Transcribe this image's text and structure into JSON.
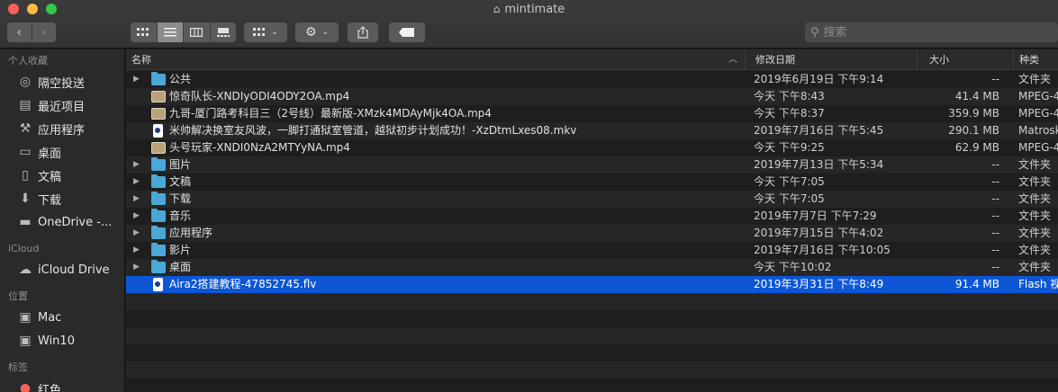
{
  "window": {
    "title": "mintimate"
  },
  "toolbar": {
    "back": "‹",
    "forward": "›",
    "search_placeholder": "搜索"
  },
  "sidebar": {
    "sections": [
      {
        "title": "个人收藏",
        "items": [
          {
            "label": "隔空投送",
            "icon": "airdrop-icon"
          },
          {
            "label": "最近项目",
            "icon": "recents-icon"
          },
          {
            "label": "应用程序",
            "icon": "applications-icon"
          },
          {
            "label": "桌面",
            "icon": "desktop-icon"
          },
          {
            "label": "文稿",
            "icon": "documents-icon"
          },
          {
            "label": "下载",
            "icon": "downloads-icon"
          },
          {
            "label": "OneDrive -...",
            "icon": "folder-icon"
          }
        ]
      },
      {
        "title": "iCloud",
        "items": [
          {
            "label": "iCloud Drive",
            "icon": "cloud-icon"
          }
        ]
      },
      {
        "title": "位置",
        "items": [
          {
            "label": "Mac",
            "icon": "disk-icon"
          },
          {
            "label": "Win10",
            "icon": "disk-icon"
          }
        ]
      },
      {
        "title": "标签",
        "items": [
          {
            "label": "红色",
            "icon": "red-tag-icon"
          }
        ]
      }
    ]
  },
  "columns": {
    "name": "名称",
    "date": "修改日期",
    "size": "大小",
    "kind": "种类"
  },
  "files": [
    {
      "name": "公共",
      "date": "2019年6月19日 下午9:14",
      "size": "--",
      "kind": "文件夹",
      "type": "folder"
    },
    {
      "name": "惊奇队长-XNDIyODI4ODY2OA.mp4",
      "date": "今天 下午8:43",
      "size": "41.4 MB",
      "kind": "MPEG-4",
      "type": "video"
    },
    {
      "name": "九哥-厦门路考科目三（2号线）最新版-XMzk4MDAyMjk4OA.mp4",
      "date": "今天 下午8:37",
      "size": "359.9 MB",
      "kind": "MPEG-4",
      "type": "video"
    },
    {
      "name": "米帅解决换室友风波，一脚打通狱室管道，越狱初步计划成功！-XzDtmLxes08.mkv",
      "date": "2019年7月16日 下午5:45",
      "size": "290.1 MB",
      "kind": "Matroska",
      "type": "doc"
    },
    {
      "name": "头号玩家-XNDI0NzA2MTYyNA.mp4",
      "date": "今天 下午9:25",
      "size": "62.9 MB",
      "kind": "MPEG-4",
      "type": "video"
    },
    {
      "name": "图片",
      "date": "2019年7月13日 下午5:34",
      "size": "--",
      "kind": "文件夹",
      "type": "folder"
    },
    {
      "name": "文稿",
      "date": "今天 下午7:05",
      "size": "--",
      "kind": "文件夹",
      "type": "folder"
    },
    {
      "name": "下载",
      "date": "今天 下午7:05",
      "size": "--",
      "kind": "文件夹",
      "type": "folder"
    },
    {
      "name": "音乐",
      "date": "2019年7月7日 下午7:29",
      "size": "--",
      "kind": "文件夹",
      "type": "folder"
    },
    {
      "name": "应用程序",
      "date": "2019年7月15日 下午4:02",
      "size": "--",
      "kind": "文件夹",
      "type": "folder"
    },
    {
      "name": "影片",
      "date": "2019年7月16日 下午10:05",
      "size": "--",
      "kind": "文件夹",
      "type": "folder"
    },
    {
      "name": "桌面",
      "date": "今天 下午10:02",
      "size": "--",
      "kind": "文件夹",
      "type": "folder"
    },
    {
      "name": "Aira2搭建教程-47852745.flv",
      "date": "2019年3月31日 下午8:49",
      "size": "91.4 MB",
      "kind": "Flash 视频",
      "type": "doc",
      "selected": true
    }
  ],
  "colors": {
    "selection": "#0d56d5",
    "folder": "#4aa8d8",
    "background": "#1e1e1e",
    "sidebar": "#2a2a2a"
  }
}
